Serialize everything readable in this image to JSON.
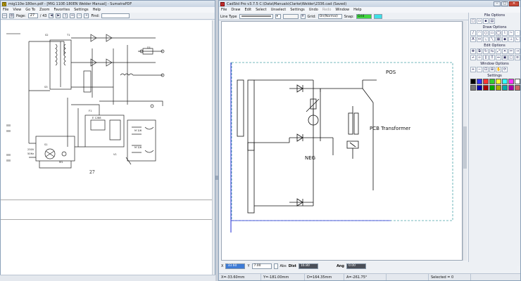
{
  "left_window": {
    "title": "mig110e-180en.pdf - [MIG 110E-180EN Welder Manual] - SumatraPDF",
    "app_icon": "sumatra-icon",
    "menu": [
      "File",
      "View",
      "Go To",
      "Zoom",
      "Favorites",
      "Settings",
      "Help"
    ],
    "toolbar": {
      "page_label": "Page:",
      "page_value": "27",
      "page_total": "/ 43",
      "find_label": "Find:"
    },
    "page_number": "27"
  },
  "right_window": {
    "title": "CadStd Pro v3.7.5  C:\\Data\\Manuals\\Clarke\\Welder\\2336.cad  (Saved)",
    "menu": [
      "File",
      "Draw",
      "Edit",
      "Select",
      "Unselect",
      "Settings",
      "Undo",
      "Redo",
      "Window",
      "Help"
    ],
    "menu_disabled": [
      "Redo"
    ],
    "toolbar": {
      "line_type_label": "Line Type",
      "grid_label": "Grid:",
      "grid_value": "On(Normal)",
      "snap_label": "Snap:",
      "snap_value": "Grid"
    },
    "drawing_labels": {
      "pos": "POS",
      "neg": "NEG",
      "pcb": "PCB Transformer"
    },
    "palette": {
      "file_options": "File Options",
      "draw_options": "Draw Options",
      "edit_options": "Edit Options",
      "window_options": "Window Options",
      "settings": "Settings"
    },
    "color_swatches": [
      "#000000",
      "#3333ff",
      "#ff3333",
      "#33cc33",
      "#ffff33",
      "#33ffff",
      "#ff33ff",
      "#ffffff",
      "#777777",
      "#0000aa",
      "#aa0000",
      "#00aa00",
      "#aaaa00",
      "#00aaaa",
      "#aa00aa",
      "#cc6666"
    ],
    "cmdbar": {
      "x_label": "X",
      "x_value": "33.60",
      "y_label": "Y",
      "y_value": "7.00",
      "abs_label": "Abs",
      "dist_label": "Dist",
      "dist_value": "16.80",
      "ang_label": "Ang",
      "ang_value": "0.00"
    },
    "status": {
      "x": "X=-33.60mm",
      "y": "Y=-181.00mm",
      "d": "D=164.35mm",
      "a": "A=-261.75°",
      "selected": "Selected = 0"
    }
  }
}
